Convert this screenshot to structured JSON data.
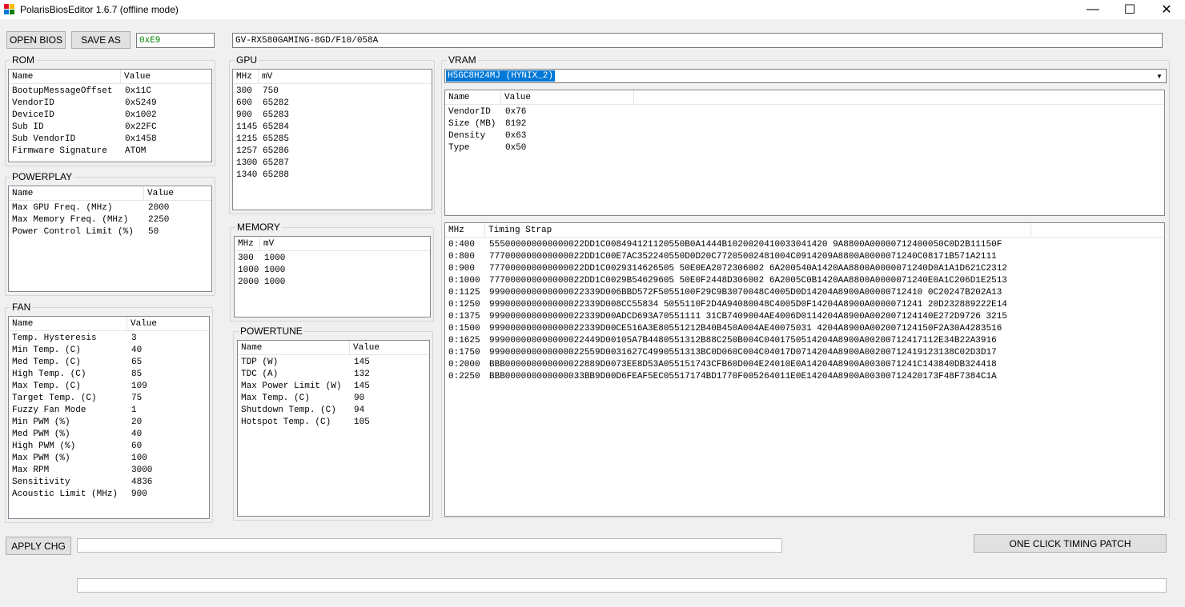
{
  "window": {
    "title": "PolarisBiosEditor 1.6.7 (offline mode)",
    "minimize": "—",
    "maximize": "☐",
    "close": "✕"
  },
  "toolbar": {
    "open_label": "OPEN BIOS",
    "save_label": "SAVE AS",
    "checksum_value": "0xE9",
    "bios_name_value": "GV-RX580GAMING-8GD/F10/058A",
    "checksum_color": "#008000"
  },
  "rom": {
    "legend": "ROM",
    "columns": [
      "Name",
      "Value"
    ],
    "rows": [
      [
        "BootupMessageOffset",
        "0x11C"
      ],
      [
        "VendorID",
        "0x5249"
      ],
      [
        "DeviceID",
        "0x1002"
      ],
      [
        "Sub ID",
        "0x22FC"
      ],
      [
        "Sub VendorID",
        "0x1458"
      ],
      [
        "Firmware Signature",
        "ATOM"
      ]
    ]
  },
  "powerplay": {
    "legend": "POWERPLAY",
    "columns": [
      "Name",
      "Value"
    ],
    "rows": [
      [
        "Max GPU Freq. (MHz)",
        "2000"
      ],
      [
        "Max Memory Freq. (MHz)",
        "2250"
      ],
      [
        "Power Control Limit (%)",
        "50"
      ]
    ]
  },
  "fan": {
    "legend": "FAN",
    "columns": [
      "Name",
      "Value"
    ],
    "rows": [
      [
        "Temp. Hysteresis",
        "3"
      ],
      [
        "Min Temp. (C)",
        "40"
      ],
      [
        "Med Temp. (C)",
        "65"
      ],
      [
        "High Temp. (C)",
        "85"
      ],
      [
        "Max Temp. (C)",
        "109"
      ],
      [
        "Target Temp. (C)",
        "75"
      ],
      [
        "Fuzzy Fan Mode",
        "1"
      ],
      [
        "Min PWM (%)",
        "20"
      ],
      [
        "Med PWM (%)",
        "40"
      ],
      [
        "High PWM (%)",
        "60"
      ],
      [
        "Max PWM (%)",
        "100"
      ],
      [
        "Max RPM",
        "3000"
      ],
      [
        "Sensitivity",
        "4836"
      ],
      [
        "Acoustic Limit (MHz)",
        "900"
      ]
    ]
  },
  "gpu": {
    "legend": "GPU",
    "columns": [
      "MHz",
      "mV"
    ],
    "rows": [
      [
        "300",
        "750"
      ],
      [
        "600",
        "65282"
      ],
      [
        "900",
        "65283"
      ],
      [
        "1145",
        "65284"
      ],
      [
        "1215",
        "65285"
      ],
      [
        "1257",
        "65286"
      ],
      [
        "1300",
        "65287"
      ],
      [
        "1340",
        "65288"
      ]
    ]
  },
  "memory": {
    "legend": "MEMORY",
    "columns": [
      "MHz",
      "mV"
    ],
    "rows": [
      [
        "300",
        "1000"
      ],
      [
        "1000",
        "1000"
      ],
      [
        "2000",
        "1000"
      ]
    ]
  },
  "powertune": {
    "legend": "POWERTUNE",
    "columns": [
      "Name",
      "Value"
    ],
    "rows": [
      [
        "TDP (W)",
        "145"
      ],
      [
        "TDC (A)",
        "132"
      ],
      [
        "Max Power Limit (W)",
        "145"
      ],
      [
        "Max Temp. (C)",
        "90"
      ],
      [
        "Shutdown Temp. (C)",
        "94"
      ],
      [
        "Hotspot Temp. (C)",
        "105"
      ]
    ]
  },
  "vram": {
    "legend": "VRAM",
    "selected_module": "H5GC8H24MJ (HYNIX_2)",
    "info_columns": [
      "Name",
      "Value"
    ],
    "info_rows": [
      [
        "VendorID",
        "0x76"
      ],
      [
        "Size (MB)",
        "8192"
      ],
      [
        "Density",
        "0x63"
      ],
      [
        "Type",
        "0x50"
      ]
    ],
    "timing_columns": [
      "MHz",
      "Timing Strap"
    ],
    "timing_rows": [
      [
        "0:400",
        "555000000000000022DD1C008494121120550B0A1444B1020020410033041420 9A8800A00000712400050C0D2B11150F"
      ],
      [
        "0:800",
        "777000000000000022DD1C00E7AC352240550D0D20C77205002481004C0914209A8800A0000071240C08171B571A2111"
      ],
      [
        "0:900",
        "777000000000000022DD1C0029314626505 50E0EA2072306002 6A200540A1420AA8800A0000071240D0A1A1D621C2312"
      ],
      [
        "0:1000",
        "777000000000000022DD1C0029B54629605 50E0F2448D306002 6A2005C0B1420AA8800A0000071240E0A1C206D1E2513"
      ],
      [
        "0:1125",
        "999000000000000022339D006BBD572F5055100F29C9B3070048C4005D0D14204A8900A00000712410 0C20247B202A13"
      ],
      [
        "0:1250",
        "999000000000000022339D008CC55834 5055110F2D4A94080048C4005D0F14204A8900A0000071241 20D232889222E14"
      ],
      [
        "0:1375",
        "999000000000000022339D00ADCD693A70551111 31CB7409004AE4006D0114204A8900A002007124140E272D9726 3215"
      ],
      [
        "0:1500",
        "999000000000000022339D00CE516A3E80551212B40B450A004AE40075031 4204A8900A002007124150F2A30A4283516"
      ],
      [
        "0:1625",
        "999000000000000022449D00105A7B4480551312B88C250B004C0401750514204A8900A00200712417112E34B22A3916"
      ],
      [
        "0:1750",
        "999000000000000022559D0031627C4990551313BC0D060C004C04017D0714204A8900A00200712419123138C02D3D17"
      ],
      [
        "0:2000",
        "BBB000000000000022889D0073EE8D53A055151743CFB60D004E24010E0A14204A8900A0030071241C143840DB324418"
      ],
      [
        "0:2250",
        "BBB000000000000033BB9D00D6FEAF5EC05517174BD1770F005264011E0E14204A8900A00300712420173F48F7384C1A"
      ]
    ]
  },
  "bottom": {
    "apply_label": "APPLY CHG",
    "timing_patch_label": "ONE CLICK TIMING PATCH"
  }
}
